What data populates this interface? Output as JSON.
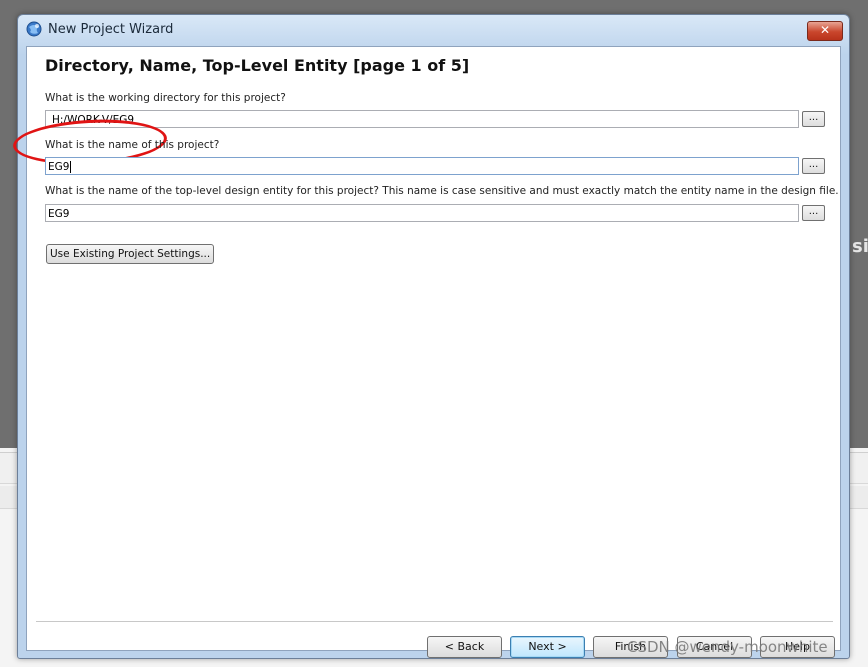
{
  "window": {
    "title": "New Project Wizard",
    "close_label": "✕"
  },
  "page": {
    "title": "Directory, Name, Top-Level Entity [page 1 of 5]"
  },
  "fields": {
    "directory": {
      "label": "What is the working directory for this project?",
      "value": "H:/WORK-V/EG9",
      "browse_label": "..."
    },
    "name": {
      "label": "What is the name of this project?",
      "value": "EG9",
      "browse_label": "..."
    },
    "top_level": {
      "label": "What is the name of the top-level design entity for this project? This name is case sensitive and must exactly match the entity name in the design file.",
      "value": "EG9",
      "browse_label": "..."
    }
  },
  "use_existing_label": "Use Existing Project Settings...",
  "buttons": {
    "back": "< Back",
    "next": "Next >",
    "finish": "Finish",
    "cancel": "Cancel",
    "help": "Help"
  },
  "watermark": "CSDN @wendy-moonwhite",
  "background_text": "si",
  "colors": {
    "highlight": "#e01414",
    "default_button": "#3c7fb1"
  },
  "icons": {
    "app": "wizard-globe-icon",
    "close": "close-icon"
  }
}
